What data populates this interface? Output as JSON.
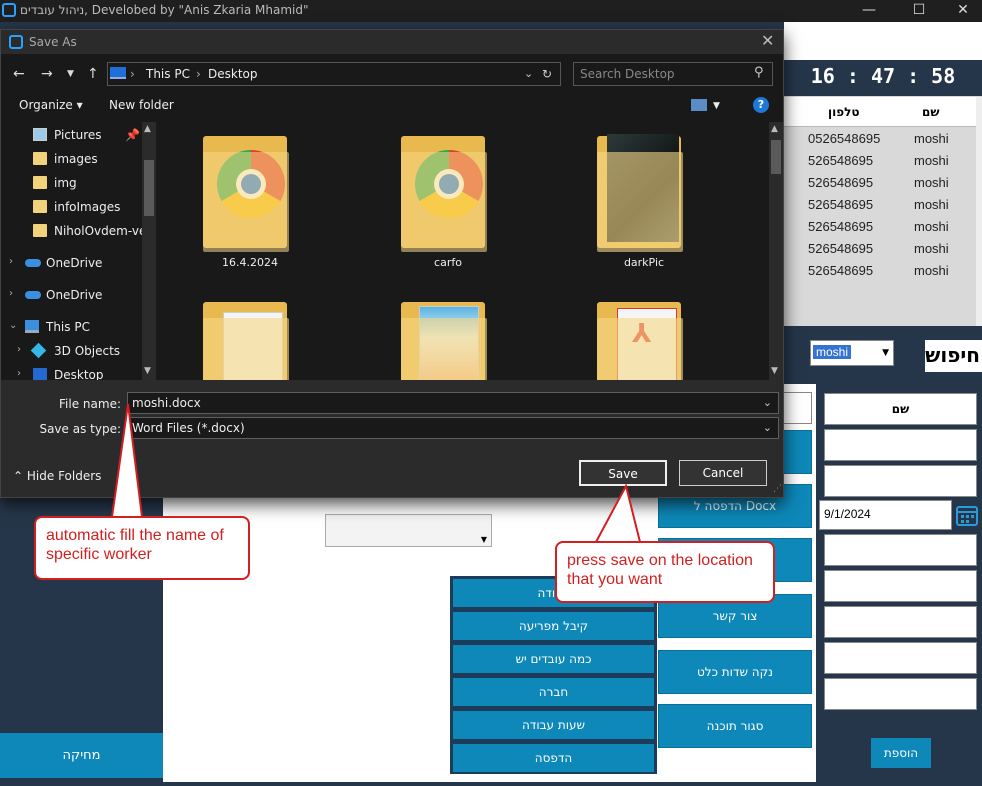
{
  "app": {
    "title": "ניהול עובדים, Develobed by \"Anis Zkaria Mhamid\"",
    "controls": {
      "minimize": "—",
      "maximize": "☐",
      "close": "✕"
    },
    "clock": "16 : 47 : 58"
  },
  "grid": {
    "columns": [
      "שם",
      "טלפון"
    ],
    "rows": [
      {
        "name": "moshi",
        "phone": "0526548695"
      },
      {
        "name": "moshi",
        "phone": "526548695"
      },
      {
        "name": "moshi",
        "phone": "526548695"
      },
      {
        "name": "moshi",
        "phone": "526548695"
      },
      {
        "name": "moshi",
        "phone": "526548695"
      },
      {
        "name": "moshi",
        "phone": "526548695"
      },
      {
        "name": "moshi",
        "phone": "526548695"
      }
    ]
  },
  "search": {
    "combo_value": "moshi",
    "label": "חיפוש"
  },
  "form": {
    "name_label": "שם",
    "date_value": "9/1/2024",
    "add_label": "הוספת"
  },
  "left_panel": {
    "delete_label": "מחיקה"
  },
  "action_buttons": {
    "docx": "הדפסה ל Docx",
    "contact": "צור קשר",
    "clear": "נקה שדות כלט",
    "close": "סגור תוכנה"
  },
  "list_buttons": [
    "עבודה",
    "קיבל מפריעה",
    "כמה עובדים יש",
    "חברה",
    "שעות עבודה",
    "הדפסה"
  ],
  "dialog": {
    "title": "Save As",
    "close": "✕",
    "breadcrumbs": [
      "This PC",
      "Desktop"
    ],
    "search_placeholder": "Search Desktop",
    "organize": "Organize ▾",
    "new_folder": "New folder",
    "help": "?",
    "nav_items": [
      {
        "label": "Pictures",
        "icon": "pictures-icon"
      },
      {
        "label": "images",
        "icon": "folder-icon"
      },
      {
        "label": "img",
        "icon": "folder-icon"
      },
      {
        "label": "infoImages",
        "icon": "folder-icon"
      },
      {
        "label": "NiholOvdem-ve",
        "icon": "folder-icon"
      },
      {
        "label": "OneDrive",
        "icon": "cloud-icon"
      },
      {
        "label": "OneDrive",
        "icon": "cloud-icon"
      },
      {
        "label": "This PC",
        "icon": "pc-icon"
      },
      {
        "label": "3D Objects",
        "icon": "cube-icon"
      },
      {
        "label": "Desktop",
        "icon": "desktop-icon"
      }
    ],
    "files": [
      {
        "label": "16.4.2024",
        "kind": "chrome"
      },
      {
        "label": "carfo",
        "kind": "chrome"
      },
      {
        "label": "darkPic",
        "kind": "dark"
      },
      {
        "label": "",
        "kind": "docs"
      },
      {
        "label": "",
        "kind": "web"
      },
      {
        "label": "",
        "kind": "pdf"
      }
    ],
    "file_name_label": "File name:",
    "file_name_value": "moshi.docx",
    "save_type_label": "Save as type:",
    "save_type_value": "Word Files (*.docx)",
    "hide_folders": "Hide Folders",
    "save": "Save",
    "cancel": "Cancel"
  },
  "callouts": {
    "autofill": "automatic fill the name of specific worker",
    "save": "press save on the location that you want"
  },
  "colors": {
    "accent": "#0d88b8",
    "navy": "#26364a",
    "callout": "#d21f1f"
  }
}
